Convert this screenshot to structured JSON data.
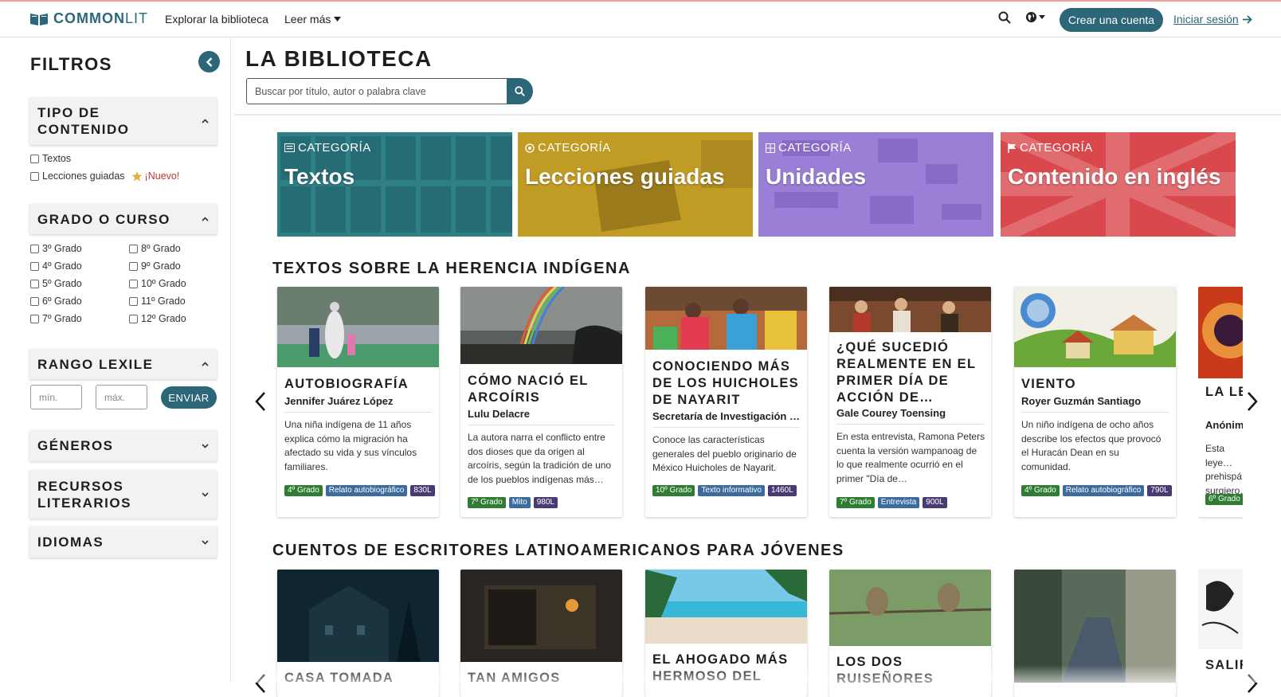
{
  "nav": {
    "logo_bold": "COMMON",
    "logo_light": "LIT",
    "explore": "Explorar la biblioteca",
    "read_more": "Leer más",
    "create_account": "Crear una cuenta",
    "login": "Iniciar sesión"
  },
  "sidebar": {
    "title": "FILTROS",
    "content_type": {
      "label": "TIPO DE CONTENIDO",
      "options": [
        "Textos",
        "Lecciones guiadas"
      ],
      "new_badge": "¡Nuevo!"
    },
    "grade": {
      "label": "GRADO O CURSO",
      "col1": [
        "3º Grado",
        "4º Grado",
        "5º Grado",
        "6º Grado",
        "7º Grado"
      ],
      "col2": [
        "8º Grado",
        "9º Grado",
        "10º Grado",
        "11º Grado",
        "12º Grado"
      ]
    },
    "lexile": {
      "label": "RANGO LEXILE",
      "min_placeholder": "mín.",
      "max_placeholder": "máx.",
      "submit": "ENVIAR"
    },
    "genres": "GÉNEROS",
    "literary": "RECURSOS LITERARIOS",
    "languages": "IDIOMAS"
  },
  "main": {
    "title": "LA BIBLIOTECA",
    "search_placeholder": "Buscar por título, autor o palabra clave"
  },
  "categories": [
    {
      "tag": "CATEGORÍA",
      "name": "Textos",
      "color": "#2f7f86"
    },
    {
      "tag": "CATEGORÍA",
      "name": "Lecciones guiadas",
      "color": "#c9a32a"
    },
    {
      "tag": "CATEGORÍA",
      "name": "Unidades",
      "color": "#9b7fd6"
    },
    {
      "tag": "CATEGORÍA",
      "name": "Contenido en inglés",
      "color": "#d9484d"
    }
  ],
  "section1": {
    "title": "TEXTOS SOBRE LA HERENCIA INDÍGENA",
    "cards": [
      {
        "title": "Autobiografía",
        "author": "Jennifer Juárez López",
        "desc": "Una niña indígena de 11 años explica cómo la migración ha afectado su vida y sus vínculos familiares.",
        "badges": [
          "4º Grado",
          "Relato autobiográfico",
          "830L"
        ]
      },
      {
        "title": "Cómo nació el arcoíris",
        "author": "Lulu Delacre",
        "desc": "La autora narra el conflicto entre dos dioses que da origen al arcoíris, según la tradición de uno de los pueblos indígenas más…",
        "badges": [
          "7º Grado",
          "Mito",
          "980L"
        ]
      },
      {
        "title": "Conociendo más de los Huicholes de Nayarit",
        "author": "Secretaría de Investigación y…",
        "desc": "Conoce las características generales del pueblo originario de México Huicholes de Nayarit.",
        "badges": [
          "10º Grado",
          "Texto informativo",
          "1460L"
        ]
      },
      {
        "title": "¿Qué sucedió realmente en el primer Día de Acción de…",
        "author": "Gale Courey Toensing",
        "desc": "En esta entrevista, Ramona Peters cuenta la versión wampanoag de lo que realmente ocurrió en el primer \"Día de…",
        "badges": [
          "7º Grado",
          "Entrevista",
          "900L"
        ]
      },
      {
        "title": "Viento",
        "author": "Royer Guzmán Santiago",
        "desc": "Un niño indígena de ocho años describe los efectos que provocó el Huracán Dean en su comunidad.",
        "badges": [
          "4º Grado",
          "Relato autobiográfico",
          "790L"
        ]
      },
      {
        "title": "La le… sol y…",
        "author": "Anónim…",
        "desc": "Esta leye… prehispá… surgiero…",
        "badges": [
          "6º Grado"
        ]
      }
    ]
  },
  "section2": {
    "title": "CUENTOS DE ESCRITORES LATINOAMERICANOS PARA JÓVENES",
    "cards": [
      {
        "title": "Casa tomada"
      },
      {
        "title": "Tan amigos"
      },
      {
        "title": "El ahogado más hermoso del"
      },
      {
        "title": "Los dos ruiseñores"
      },
      {
        "title": ""
      },
      {
        "title": "Salir… domi…"
      }
    ]
  }
}
